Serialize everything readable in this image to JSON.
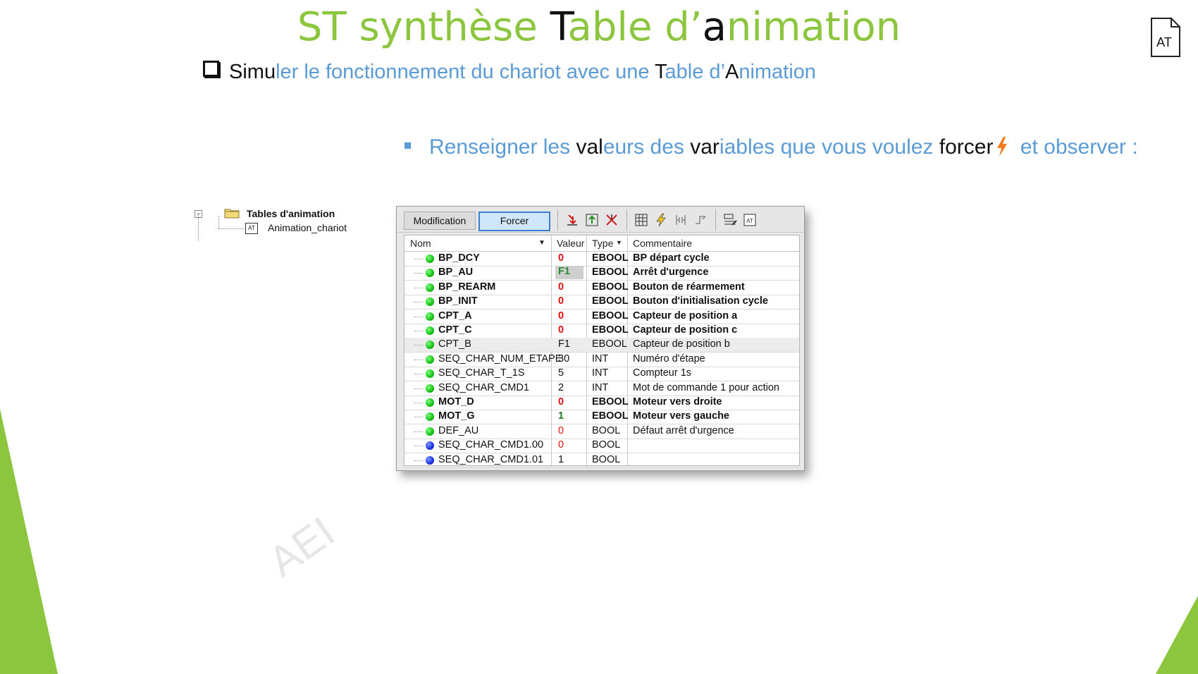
{
  "title": {
    "part1": "ST synthèse ",
    "part2": "T",
    "part3": "able d’",
    "part4": "a",
    "part5": "nimation"
  },
  "doc_icon_label": "AT",
  "bullet1": {
    "a": "Simu",
    "b": "ler le fonctionnement du chariot avec une ",
    "c": "T",
    "d": "able d’",
    "e": "A",
    "f": "nimation"
  },
  "bullet2": {
    "a": "Renseigner les ",
    "b": "val",
    "c": "eurs des ",
    "d": "var",
    "e": "iables que vous voulez ",
    "f": "forcer",
    "g": " et observer :"
  },
  "tree": {
    "folder_label": "Tables d'animation",
    "item_label": "Animation_chariot",
    "item_icon": "AT"
  },
  "toolbar": {
    "modification_label": "Modification",
    "forcer_label": "Forcer"
  },
  "columns": {
    "name": "Nom",
    "value": "Valeur",
    "type": "Type",
    "comment": "Commentaire"
  },
  "rows": [
    {
      "name": "BP_DCY",
      "value": "0",
      "type": "EBOOL",
      "comment": "BP départ cycle",
      "bold": true,
      "valstyle": "red",
      "dot": "green"
    },
    {
      "name": "BP_AU",
      "value": "F1",
      "type": "EBOOL",
      "comment": "Arrêt d'urgence",
      "bold": true,
      "valstyle": "forced",
      "dot": "green"
    },
    {
      "name": "BP_REARM",
      "value": "0",
      "type": "EBOOL",
      "comment": "Bouton de réarmement",
      "bold": true,
      "valstyle": "red",
      "dot": "green"
    },
    {
      "name": "BP_INIT",
      "value": "0",
      "type": "EBOOL",
      "comment": "Bouton d'initialisation cycle",
      "bold": true,
      "valstyle": "red",
      "dot": "green"
    },
    {
      "name": "CPT_A",
      "value": "0",
      "type": "EBOOL",
      "comment": "Capteur de position a",
      "bold": true,
      "valstyle": "red",
      "dot": "green"
    },
    {
      "name": "CPT_C",
      "value": "0",
      "type": "EBOOL",
      "comment": "Capteur de position c",
      "bold": true,
      "valstyle": "red",
      "dot": "green"
    },
    {
      "name": "CPT_B",
      "value": "F1",
      "type": "EBOOL",
      "comment": "Capteur de position b",
      "bold": false,
      "valstyle": "plain",
      "dot": "green",
      "selected": true
    },
    {
      "name": "SEQ_CHAR_NUM_ETAPE",
      "value": "30",
      "type": "INT",
      "comment": "Numéro d'étape",
      "bold": false,
      "valstyle": "plain",
      "dot": "green"
    },
    {
      "name": "SEQ_CHAR_T_1S",
      "value": "5",
      "type": "INT",
      "comment": "Compteur 1s",
      "bold": false,
      "valstyle": "plain",
      "dot": "green"
    },
    {
      "name": "SEQ_CHAR_CMD1",
      "value": "2",
      "type": "INT",
      "comment": "Mot de commande 1 pour action",
      "bold": false,
      "valstyle": "plain",
      "dot": "green"
    },
    {
      "name": "MOT_D",
      "value": "0",
      "type": "EBOOL",
      "comment": "Moteur vers droite",
      "bold": true,
      "valstyle": "red",
      "dot": "green"
    },
    {
      "name": "MOT_G",
      "value": "1",
      "type": "EBOOL",
      "comment": "Moteur vers gauche",
      "bold": true,
      "valstyle": "green",
      "dot": "green"
    },
    {
      "name": "DEF_AU",
      "value": "0",
      "type": "BOOL",
      "comment": "Défaut arrêt d'urgence",
      "bold": false,
      "valstyle": "red",
      "dot": "green"
    },
    {
      "name": "SEQ_CHAR_CMD1.00",
      "value": "0",
      "type": "BOOL",
      "comment": "",
      "bold": false,
      "valstyle": "red",
      "dot": "blue"
    },
    {
      "name": "SEQ_CHAR_CMD1.01",
      "value": "1",
      "type": "BOOL",
      "comment": "",
      "bold": false,
      "valstyle": "plain",
      "dot": "blue"
    }
  ],
  "colors": {
    "green_accent": "#8cc63f",
    "blue_text": "#5b9bd5",
    "forced_green": "#2a8a2a",
    "red_value": "#e01010"
  },
  "icons": [
    "folder-icon",
    "lightning-icon",
    "document-icon",
    "force-down-icon",
    "force-up-icon",
    "unforce-icon",
    "grid-icon",
    "flash-icon",
    "ladder-icon",
    "sequence-icon",
    "modify-value-icon",
    "animation-table-icon"
  ]
}
